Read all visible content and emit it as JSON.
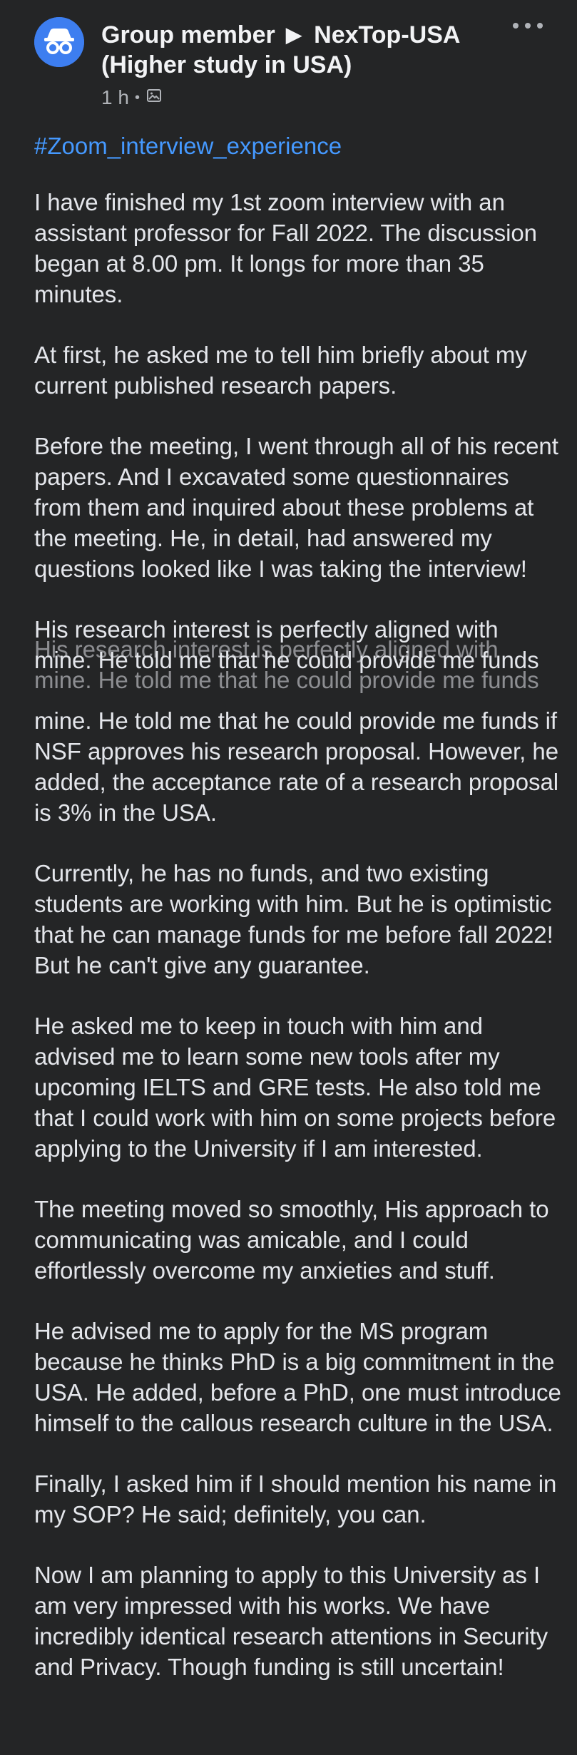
{
  "post": {
    "author": "Group member",
    "group": "NexTop-USA (Higher study in USA)",
    "time": "1 h",
    "privacy_icon": "gallery-icon",
    "hashtag": "#Zoom_interview_experience",
    "paragraphs": [
      "I have finished my 1st zoom interview with an assistant professor for Fall 2022. The discussion began at 8.00 pm. It longs for more than 35 minutes.",
      "At first, he asked me to tell him briefly about my current published research papers.",
      "Before the meeting, I went through all of his recent papers. And I excavated some questionnaires from them and inquired about these problems at the meeting. He, in detail, had answered my questions looked like I was taking the interview!",
      "His research interest is perfectly aligned with mine. He told me that he could provide me funds",
      "mine. He told me that he could provide me funds if NSF approves his research proposal. However, he added, the acceptance rate of a research proposal is 3% in the USA.",
      "Currently, he has no funds, and two existing students are working with him. But he is optimistic that he can manage funds for me before fall 2022! But he can't give any guarantee.",
      "He asked me to keep in touch with him and advised me to learn some new tools after my upcoming IELTS and GRE tests. He also told me that I could work with him on some projects before applying to the University if I am interested.",
      "The meeting moved so smoothly, His approach to communicating was amicable, and I could effortlessly overcome my anxieties and stuff.",
      "He advised me to apply for the MS program because he thinks PhD is a big commitment in the USA. He added, before a PhD, one must introduce himself to the callous research culture in the USA.",
      "Finally, I asked him if I should mention his name in my SOP? He said; definitely, you can.",
      "Now I am planning to apply to this University as I am very impressed with his works. We have incredibly identical research attentions in Security and Privacy. Though funding is still uncertain!"
    ]
  },
  "icons": {
    "avatar": "anonymous-member-icon",
    "more": "more-options-icon",
    "separator": "dot"
  },
  "colors": {
    "background": "#242526",
    "text": "#e4e6eb",
    "muted": "#b0b3b8",
    "link": "#4599ff",
    "avatar": "#3d7ef0"
  }
}
